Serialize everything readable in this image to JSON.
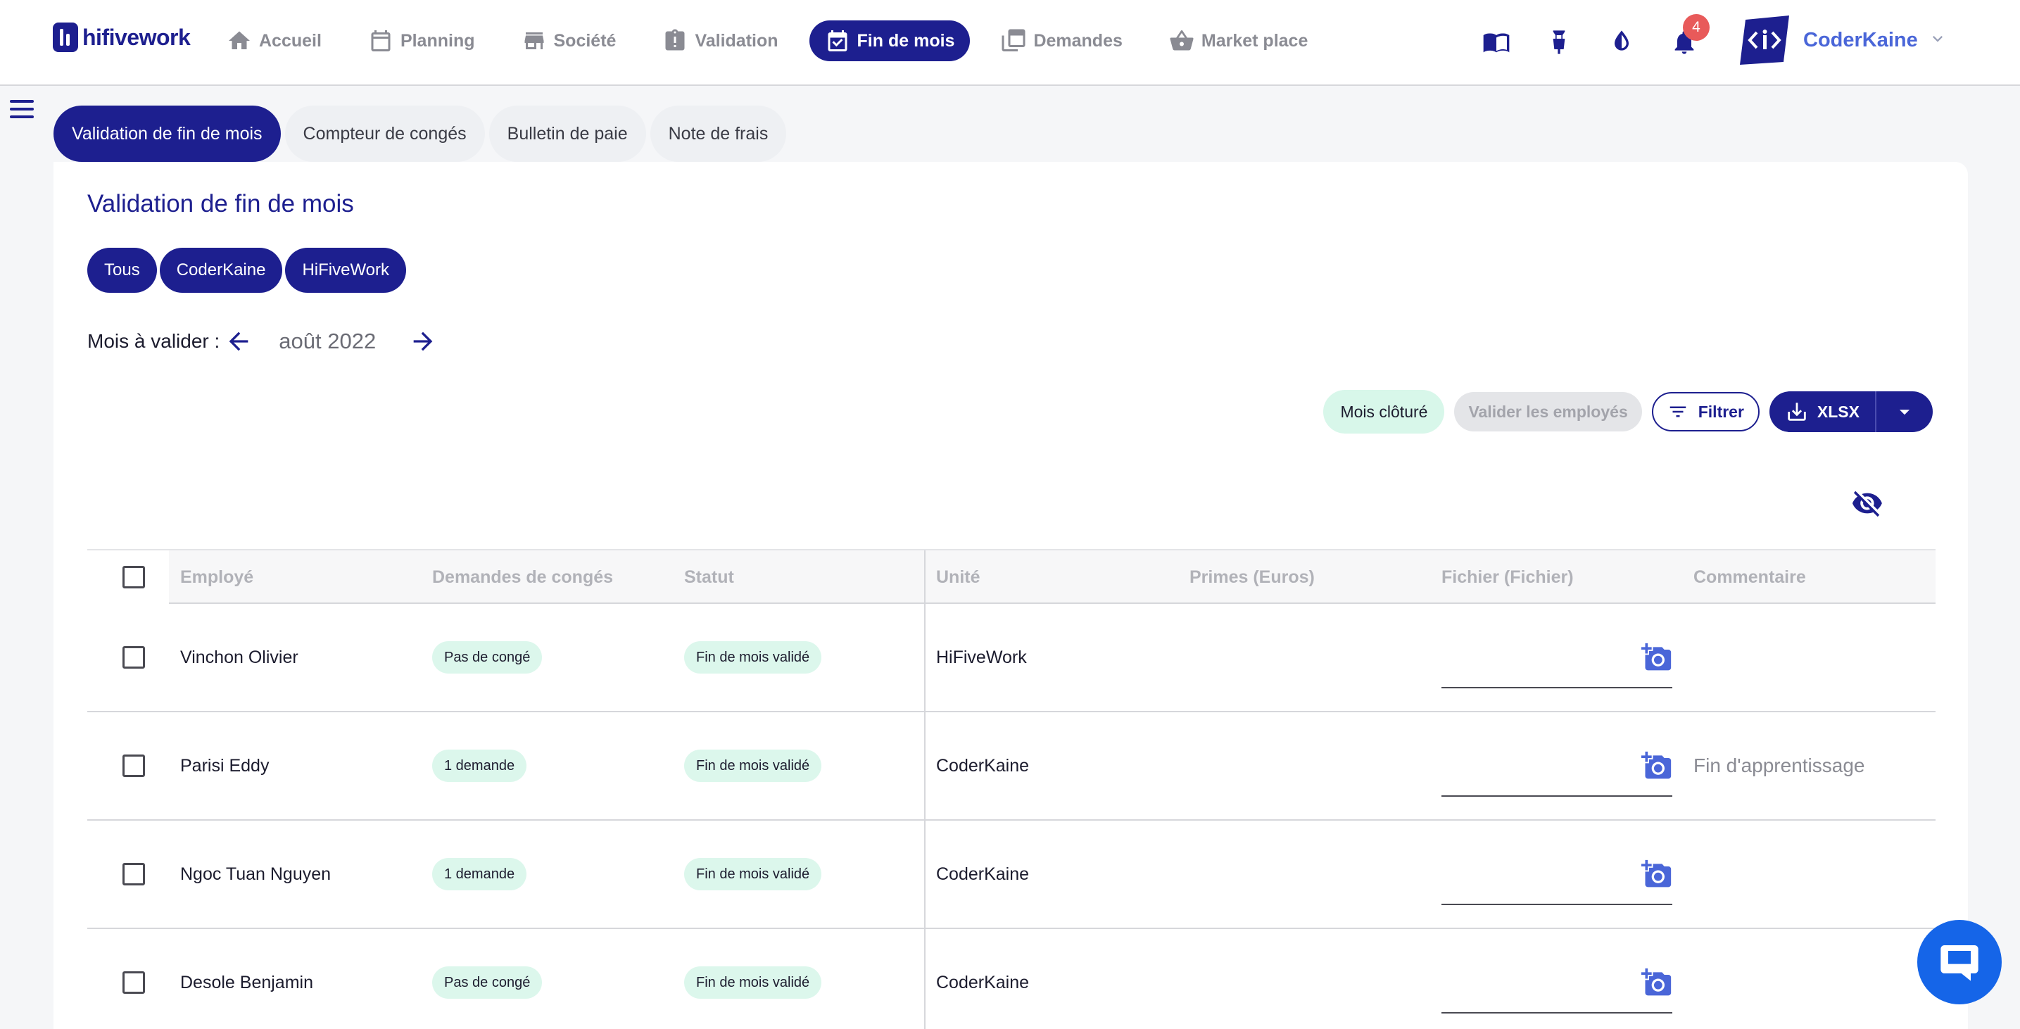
{
  "app": {
    "logo_text": "hifivework"
  },
  "nav": [
    {
      "label": "Accueil",
      "icon": "home-icon"
    },
    {
      "label": "Planning",
      "icon": "calendar-icon"
    },
    {
      "label": "Société",
      "icon": "store-icon"
    },
    {
      "label": "Validation",
      "icon": "clipboard-alert-icon"
    },
    {
      "label": "Fin de mois",
      "icon": "calendar-check-icon",
      "active": true
    },
    {
      "label": "Demandes",
      "icon": "stack-icon"
    },
    {
      "label": "Market place",
      "icon": "basket-icon"
    }
  ],
  "top_icons": {
    "book": "book-icon",
    "bulb": "lightbulb-icon",
    "contrast": "contrast-icon",
    "bell": "bell-icon",
    "notification_count": "4"
  },
  "user": {
    "name": "CoderKaine"
  },
  "subtabs": [
    {
      "label": "Validation de fin de mois",
      "active": true
    },
    {
      "label": "Compteur de congés"
    },
    {
      "label": "Bulletin de paie"
    },
    {
      "label": "Note de frais"
    }
  ],
  "page": {
    "title": "Validation de fin de mois",
    "chips": [
      "Tous",
      "CoderKaine",
      "HiFiveWork"
    ],
    "month_label": "Mois à valider :",
    "month_value": "août 2022"
  },
  "actions": {
    "closed": "Mois clôturé",
    "validate": "Valider les employés",
    "filter": "Filtrer",
    "export": "XLSX"
  },
  "table": {
    "headers": [
      "Employé",
      "Demandes de congés",
      "Statut",
      "Unité",
      "Primes (Euros)",
      "Fichier (Fichier)",
      "Commentaire"
    ],
    "rows": [
      {
        "employee": "Vinchon Olivier",
        "leave": "Pas de congé",
        "status": "Fin de mois validé",
        "unit": "HiFiveWork",
        "bonus": "",
        "comment": ""
      },
      {
        "employee": "Parisi Eddy",
        "leave": "1 demande",
        "status": "Fin de mois validé",
        "unit": "CoderKaine",
        "bonus": "",
        "comment": "Fin d'apprentissage"
      },
      {
        "employee": "Ngoc Tuan Nguyen",
        "leave": "1 demande",
        "status": "Fin de mois validé",
        "unit": "CoderKaine",
        "bonus": "",
        "comment": ""
      },
      {
        "employee": "Desole Benjamin",
        "leave": "Pas de congé",
        "status": "Fin de mois validé",
        "unit": "CoderKaine",
        "bonus": "",
        "comment": ""
      }
    ]
  },
  "colors": {
    "primary": "#1d1f8f",
    "accent": "#4a66d8",
    "success_bg": "#dcf7ec",
    "badge": "#e85a5a",
    "chat": "#1565e8"
  }
}
